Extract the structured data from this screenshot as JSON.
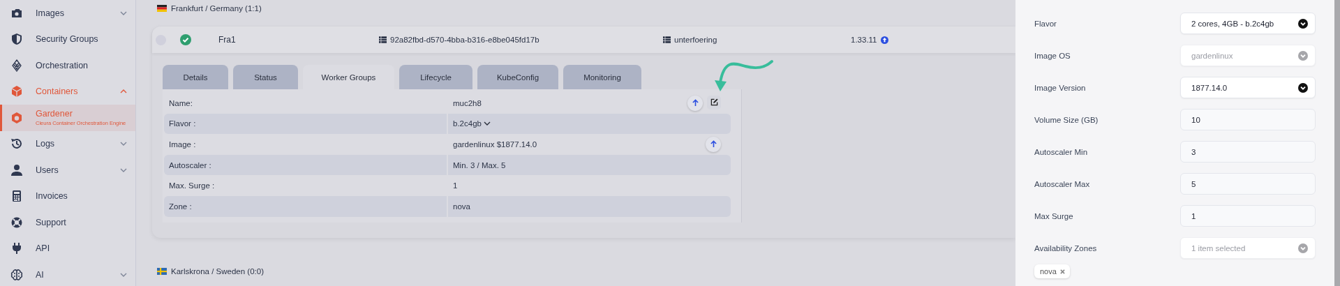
{
  "sidebar": {
    "items": [
      {
        "label": "Images",
        "expanded": false,
        "selected": false
      },
      {
        "label": "Security Groups",
        "selected": false
      },
      {
        "label": "Orchestration",
        "selected": false
      },
      {
        "label": "Containers",
        "expanded": true,
        "selected": false,
        "children": [
          {
            "label": "Gardener",
            "subtitle": "Cleura Container Orchestration Engine",
            "selected": true
          }
        ]
      },
      {
        "label": "Logs",
        "expanded": false,
        "selected": false
      },
      {
        "label": "Users",
        "expanded": false,
        "selected": false
      },
      {
        "label": "Invoices",
        "selected": false
      },
      {
        "label": "Support",
        "selected": false
      },
      {
        "label": "API",
        "selected": false
      },
      {
        "label": "AI",
        "expanded": false,
        "selected": false
      }
    ]
  },
  "regions": [
    {
      "title": "Frankfurt / Germany",
      "count": "(1:1)",
      "clusters": [
        {
          "selected": false,
          "healthy": true,
          "name": "Fra1",
          "id": "92a82fbd-d570-4bba-b316-e8be045fd17b",
          "project": "unterfoering",
          "version": "1.33.11",
          "upgrade_available": true,
          "tabs": [
            {
              "label": "Details",
              "selected": false
            },
            {
              "label": "Status",
              "selected": false
            },
            {
              "label": "Worker Groups",
              "selected": true
            },
            {
              "label": "Lifecycle",
              "selected": false
            },
            {
              "label": "KubeConfig",
              "selected": false
            },
            {
              "label": "Monitoring",
              "selected": false
            }
          ],
          "worker_group": [
            {
              "label": "Name:",
              "value": "muc2h8",
              "kind": "text",
              "upgradable": true,
              "editable": true
            },
            {
              "label": "Flavor :",
              "value": "b.2c4gb",
              "kind": "dropdown"
            },
            {
              "label": "Image :",
              "value": "gardenlinux $1877.14.0",
              "kind": "text",
              "upgradable": true
            },
            {
              "label": "Autoscaler :",
              "value": "Min. 3 / Max. 5",
              "kind": "text"
            },
            {
              "label": "Max. Surge :",
              "value": "1",
              "kind": "text"
            },
            {
              "label": "Zone :",
              "value": "nova",
              "kind": "text"
            }
          ]
        }
      ]
    },
    {
      "title": "Karlskrona / Sweden",
      "count": "(0:0)"
    }
  ],
  "edit_panel": {
    "fields": [
      {
        "label": "Flavor",
        "kind": "select",
        "value": "2 cores, 4GB - b.2c4gb",
        "disabled": false
      },
      {
        "label": "Image OS",
        "kind": "select",
        "value": "gardenlinux",
        "disabled": true
      },
      {
        "label": "Image Version",
        "kind": "select",
        "value": "1877.14.0",
        "disabled": false
      },
      {
        "label": "Volume Size (GB)",
        "kind": "input",
        "value": "10"
      },
      {
        "label": "Autoscaler Min",
        "kind": "input",
        "value": "3"
      },
      {
        "label": "Autoscaler Max",
        "kind": "input",
        "value": "5"
      },
      {
        "label": "Max Surge",
        "kind": "input",
        "value": "1"
      },
      {
        "label": "Availability Zones",
        "kind": "multiselect",
        "placeholder": "1 item selected",
        "chips": [
          "nova"
        ]
      }
    ]
  }
}
